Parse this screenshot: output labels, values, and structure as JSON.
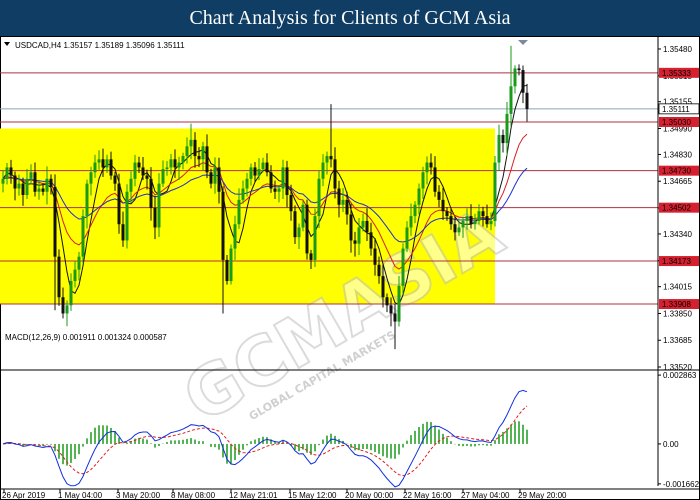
{
  "page": {
    "title": "Chart Analysis for Clients of GCM Asia"
  },
  "watermark": {
    "brand": "GCMASIA",
    "tagline": "GLOBAL CAPITAL MARKETS"
  },
  "chart_data": {
    "type": "candlestick",
    "symbol_header": "USDCAD,H4  1.35157 1.35189 1.35096 1.35111",
    "ylim": [
      1.3352,
      1.3556
    ],
    "price_ticks": [
      "1.35480",
      "1.35315",
      "1.35155",
      "1.34990",
      "1.34830",
      "1.34665",
      "1.34500",
      "1.34340",
      "1.34175",
      "1.34015",
      "1.33850",
      "1.33685",
      "1.33520"
    ],
    "x_ticks": [
      "26 Apr 2019",
      "1 May 04:00",
      "3 May 20:00",
      "8 May 08:00",
      "12 May 21:01",
      "15 May 12:00",
      "20 May 00:00",
      "22 May 16:00",
      "27 May 04:00",
      "29 May 20:00"
    ],
    "current_price": {
      "value": 1.35111,
      "label": "1.35111"
    },
    "levels": [
      {
        "value": 1.35333,
        "label": "1.35333"
      },
      {
        "value": 1.3503,
        "label": "1.35030"
      },
      {
        "value": 1.3473,
        "label": "1.34730"
      },
      {
        "value": 1.34502,
        "label": "1.34502"
      },
      {
        "value": 1.34173,
        "label": "1.34173"
      },
      {
        "value": 1.33908,
        "label": "1.33908"
      }
    ],
    "range_box": {
      "from_candle": 0,
      "to_candle": 123,
      "high": 1.3499,
      "low": 1.3391
    },
    "ma_colors": {
      "fast": "#111111",
      "mid": "#d42020",
      "slow": "#2030d0"
    },
    "colors": {
      "bull": "#1a9a1a",
      "bear": "#111111",
      "box": "#ffff00",
      "level": "#b03040",
      "macd_hist": "#1a9a1a",
      "macd_signal": "#e02020",
      "macd_line": "#1030e0"
    },
    "closes": [
      1.3468,
      1.3475,
      1.347,
      1.3462,
      1.3465,
      1.3458,
      1.3468,
      1.3472,
      1.346,
      1.3462,
      1.346,
      1.3468,
      1.3463,
      1.342,
      1.3395,
      1.3385,
      1.339,
      1.3405,
      1.3412,
      1.342,
      1.3445,
      1.3465,
      1.3472,
      1.3478,
      1.348,
      1.3475,
      1.348,
      1.347,
      1.3465,
      1.344,
      1.343,
      1.346,
      1.3468,
      1.3478,
      1.3475,
      1.347,
      1.3468,
      1.345,
      1.3438,
      1.3465,
      1.3474,
      1.3475,
      1.348,
      1.3475,
      1.3478,
      1.3482,
      1.3488,
      1.3492,
      1.3482,
      1.348,
      1.3488,
      1.3472,
      1.3465,
      1.3475,
      1.346,
      1.3418,
      1.3405,
      1.3425,
      1.344,
      1.3455,
      1.3462,
      1.3468,
      1.3475,
      1.347,
      1.3474,
      1.3478,
      1.3472,
      1.3462,
      1.346,
      1.3462,
      1.3475,
      1.3458,
      1.3448,
      1.3432,
      1.3438,
      1.3452,
      1.3422,
      1.3418,
      1.3445,
      1.3468,
      1.3478,
      1.3482,
      1.348,
      1.3462,
      1.3452,
      1.3455,
      1.3446,
      1.343,
      1.3428,
      1.3438,
      1.3442,
      1.3435,
      1.3425,
      1.3415,
      1.3408,
      1.3395,
      1.339,
      1.3385,
      1.338,
      1.3402,
      1.3425,
      1.3438,
      1.3445,
      1.3452,
      1.3462,
      1.3472,
      1.3478,
      1.3475,
      1.346,
      1.3455,
      1.3448,
      1.3445,
      1.344,
      1.3435,
      1.3438,
      1.3442,
      1.3445,
      1.344,
      1.3442,
      1.3448,
      1.3445,
      1.344,
      1.3442,
      1.3478,
      1.3495,
      1.349,
      1.3508,
      1.3525,
      1.3536,
      1.3535,
      1.3521,
      1.3511
    ],
    "macd_label": "MACD(12,26,9) 0.001911 0.001324 0.000587",
    "macd_ticks": [
      "0.002863",
      "0.00",
      "-0.001662"
    ],
    "macd_ylim": [
      -0.00175,
      0.00295
    ]
  }
}
